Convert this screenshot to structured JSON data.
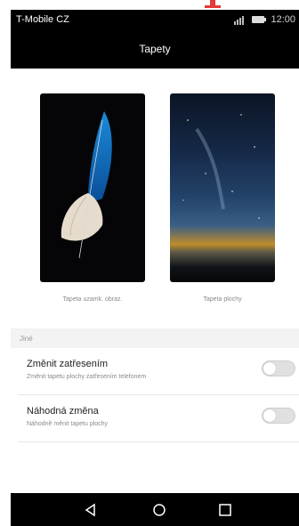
{
  "status_bar": {
    "carrier": "T-Mobile CZ",
    "time": "12:00"
  },
  "header": {
    "title": "Tapety"
  },
  "wallpapers": {
    "lock_label": "Tapeta uzamk. obraz.",
    "home_label": "Tapeta plochy"
  },
  "section": {
    "header": "Jiné"
  },
  "settings": {
    "shake_change": {
      "title": "Změnit zatřesením",
      "subtitle": "Změnit tapetu plochy zatřesením telefonem",
      "enabled": false
    },
    "random_change": {
      "title": "Náhodná změna",
      "subtitle": "Náhodně měnit tapetu plochy",
      "enabled": false
    }
  },
  "nav": {
    "icons": [
      "back-icon",
      "home-icon",
      "recents-icon"
    ]
  },
  "colors": {
    "annotation": "#e53935",
    "section_bg": "#f3f3f3",
    "toggle_off": "#e0e0e0"
  }
}
